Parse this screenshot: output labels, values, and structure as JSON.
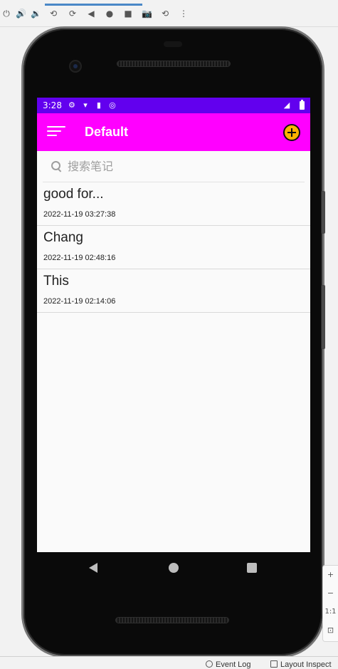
{
  "emulator_toolbar": {
    "icons": [
      "power-icon",
      "volume-up-icon",
      "volume-down-icon",
      "rotate-left-icon",
      "rotate-right-icon",
      "back-icon",
      "home-icon",
      "overview-icon",
      "camera-icon",
      "snapshot-icon",
      "more-icon"
    ]
  },
  "statusbar": {
    "time": "3:28"
  },
  "appbar": {
    "title": "Default"
  },
  "search": {
    "placeholder": "搜索笔记"
  },
  "notes": [
    {
      "title": "good for...",
      "time": "2022-11-19 03:27:38"
    },
    {
      "title": "Chang",
      "time": "2022-11-19 02:48:16"
    },
    {
      "title": "This",
      "time": "2022-11-19 02:14:06"
    }
  ],
  "zoom_panel": {
    "plus": "+",
    "minus": "−",
    "ratio": "1:1"
  },
  "bottom_bar": {
    "event_log": "Event Log",
    "layout_inspector": "Layout Inspect"
  },
  "colors": {
    "statusbar": "#6200ee",
    "appbar": "#ff00ff",
    "add_button": "#ffb300"
  }
}
